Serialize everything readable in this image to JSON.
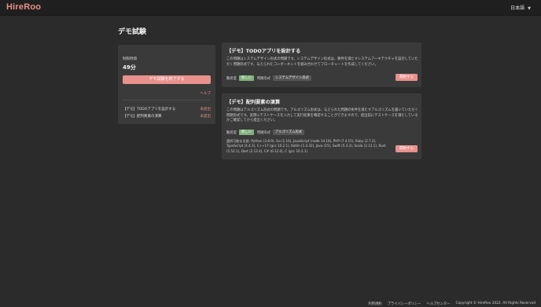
{
  "header": {
    "logo": "HireRoo",
    "language": "日本語",
    "language_chevron": "▼"
  },
  "page_title": "デモ試験",
  "sidebar": {
    "time_label": "制限時間",
    "time_value": "49分",
    "end_button": "デモ試験を終了する",
    "help_link": "ヘルプ",
    "problems": [
      {
        "title": "【デモ】TODOアプリを設計する",
        "status": "未提出"
      },
      {
        "title": "【デモ】配列要素の演算",
        "status": "未提出"
      }
    ]
  },
  "cards": [
    {
      "title": "【デモ】TODOアプリを設計する",
      "description": "この問題はシステムデザイン形式の問題です。システムデザイン形式は、要件を満たすシステムアーキテクチャを設計していただく問題形式です。与えられたコンポーネントを組み合わせてフローチャートを作成してください。",
      "difficulty_label": "難易度",
      "difficulty": "易しい",
      "type_label": "問題形式",
      "type": "システムデザイン形式",
      "start_button": "開始する"
    },
    {
      "title": "【デモ】配列要素の演算",
      "description": "この問題はアルゴリズム形式の問題です。アルゴリズム形式は、与えられた問題の条件を満たすアルゴリズムを書いていただく問題形式です。実際にテストケースを入力して実行結果を確認することができますので、提出前にテストケースを満たしているかご確認してから提出ください。",
      "difficulty_label": "難易度",
      "difficulty": "易しい",
      "type_label": "問題形式",
      "type": "アルゴリズム形式",
      "languages": "選択可能な言語: Python (3.8.9), Go (1.16), JavaScript (node 14.16), PHP (7.4.15), Ruby (2.7.2), TypeScript (4.4.3), C++17 (gcc 10.2.1), Kotlin (1.4.32), Java (15), Swift (5.3.3), Scala (2.13.1), Rust (1.52.1), Dart (2.13.4), C# (6.12.0), C (gcc 10.2.1)",
      "start_button": "開始する"
    }
  ],
  "footer": {
    "terms": "利用規約",
    "privacy": "プライバシーポリシー",
    "help_center": "ヘルプセンター",
    "copyright": "Copyright © HireRoo 2022. All Rights Reserved"
  }
}
